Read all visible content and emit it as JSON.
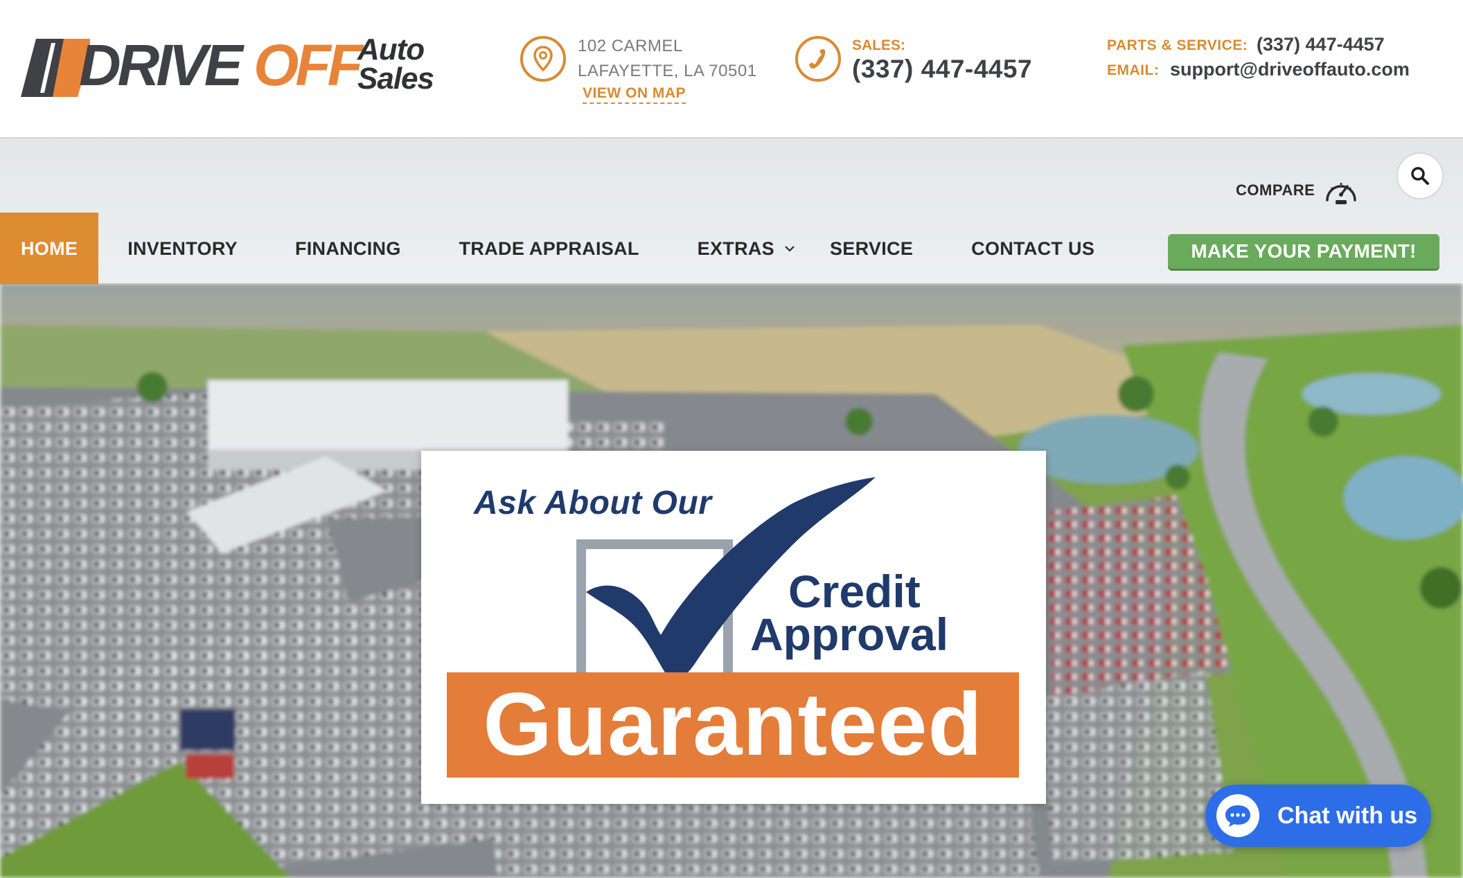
{
  "brand": {
    "logo_primary": "DRIVE",
    "logo_accent": "OFF",
    "logo_auto": "Auto",
    "logo_sales": "Sales",
    "accent_color": "#de8c32",
    "dark_color": "#3f4146"
  },
  "header": {
    "address_line1": "102 CARMEL",
    "address_line2": "LAFAYETTE, LA 70501",
    "view_on_map": "VIEW ON MAP",
    "sales_label": "SALES:",
    "sales_phone": "(337) 447-4457",
    "parts_service_label": "PARTS & SERVICE:",
    "parts_service_phone": "(337) 447-4457",
    "email_label": "EMAIL:",
    "email_value": "support@driveoffauto.com",
    "icons": [
      "map-pin-icon",
      "phone-icon"
    ]
  },
  "utility": {
    "compare_label": "COMPARE",
    "compare_icon": "speedometer-icon",
    "search_icon": "search-icon"
  },
  "nav": {
    "items": [
      {
        "label": "HOME",
        "active": true
      },
      {
        "label": "INVENTORY",
        "active": false
      },
      {
        "label": "FINANCING",
        "active": false
      },
      {
        "label": "TRADE APPRAISAL",
        "active": false
      },
      {
        "label": "EXTRAS",
        "active": false,
        "has_dropdown": true
      },
      {
        "label": "SERVICE",
        "active": false
      },
      {
        "label": "CONTACT US",
        "active": false
      }
    ],
    "payment_button": "MAKE YOUR PAYMENT!",
    "payment_color": "#6aab5b"
  },
  "hero": {
    "promo": {
      "ask": "Ask About Our",
      "credit": "Credit",
      "approval": "Approval",
      "guaranteed": "Guaranteed",
      "navy": "#1f3a6b",
      "orange": "#e47c3a"
    },
    "chat_label": "Chat with us",
    "chat_color": "#2d6ee8"
  }
}
